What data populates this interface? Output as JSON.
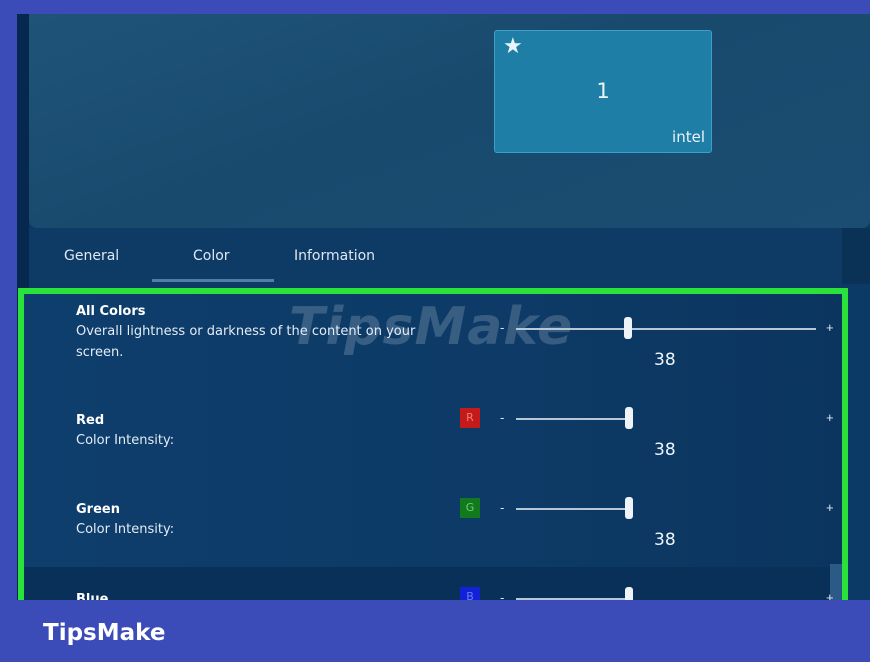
{
  "monitor": {
    "star_icon": "star-icon",
    "number": "1",
    "brand": "intel"
  },
  "tabs": [
    {
      "label": "General"
    },
    {
      "label": "Color"
    },
    {
      "label": "Information"
    }
  ],
  "active_tab": "Color",
  "watermark": "TipsMake",
  "rows": [
    {
      "title": "All Colors",
      "desc_line1": "Overall lightness or darkness of the content on your",
      "desc_line2": "screen.",
      "value": "38"
    },
    {
      "title": "Red",
      "desc": "Color Intensity:",
      "chip": "R",
      "chip_color": "#c41a1a",
      "value": "38"
    },
    {
      "title": "Green",
      "desc": "Color Intensity:",
      "chip": "G",
      "chip_color": "#117a1d",
      "value": "38"
    },
    {
      "title": "Blue",
      "chip": "B",
      "chip_color": "#1220d6"
    }
  ],
  "slider_minus": "-",
  "slider_plus": "+",
  "highlight_color": "#29e33b",
  "footer": {
    "brand": "TipsMake"
  }
}
